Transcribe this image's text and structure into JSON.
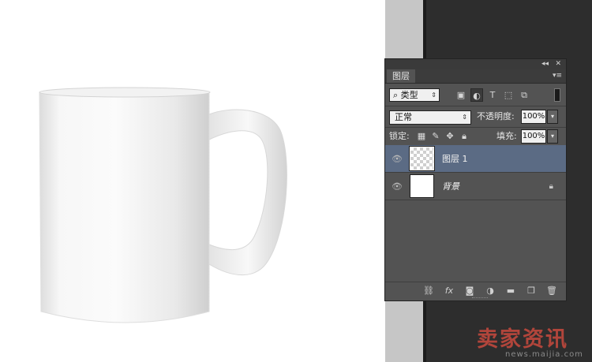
{
  "panel": {
    "collapse_glyph": "◂◂",
    "close_glyph": "✕",
    "tab_label": "图层",
    "menu_glyph": "▾≡"
  },
  "filter": {
    "search_glyph": "⌕",
    "kind_label": "类型",
    "arrow_glyph": "⇕",
    "icons": [
      "image-filter-icon",
      "adjustment-filter-icon",
      "type-filter-icon",
      "shape-filter-icon",
      "smart-object-filter-icon"
    ]
  },
  "blend": {
    "mode": "正常",
    "opacity_label": "不透明度:",
    "opacity_value": "100%"
  },
  "lock": {
    "label": "锁定:",
    "fill_label": "填充:",
    "fill_value": "100%"
  },
  "layers": [
    {
      "name": "图层 1",
      "selected": true,
      "visible": true,
      "locked": false
    },
    {
      "name": "背景",
      "selected": false,
      "visible": true,
      "locked": true
    }
  ],
  "bottom_icons": [
    "link-icon",
    "fx-icon",
    "mask-icon",
    "adjustment-icon",
    "folder-icon",
    "new-layer-icon",
    "trash-icon"
  ],
  "watermark": {
    "text": "卖家资讯",
    "sub": "news.maijia.com"
  },
  "colors": {
    "selected_layer": "#5b6b84",
    "panel_bg": "#535353",
    "workspace_bg": "#2d2d2d",
    "watermark": "#c94a3e"
  }
}
